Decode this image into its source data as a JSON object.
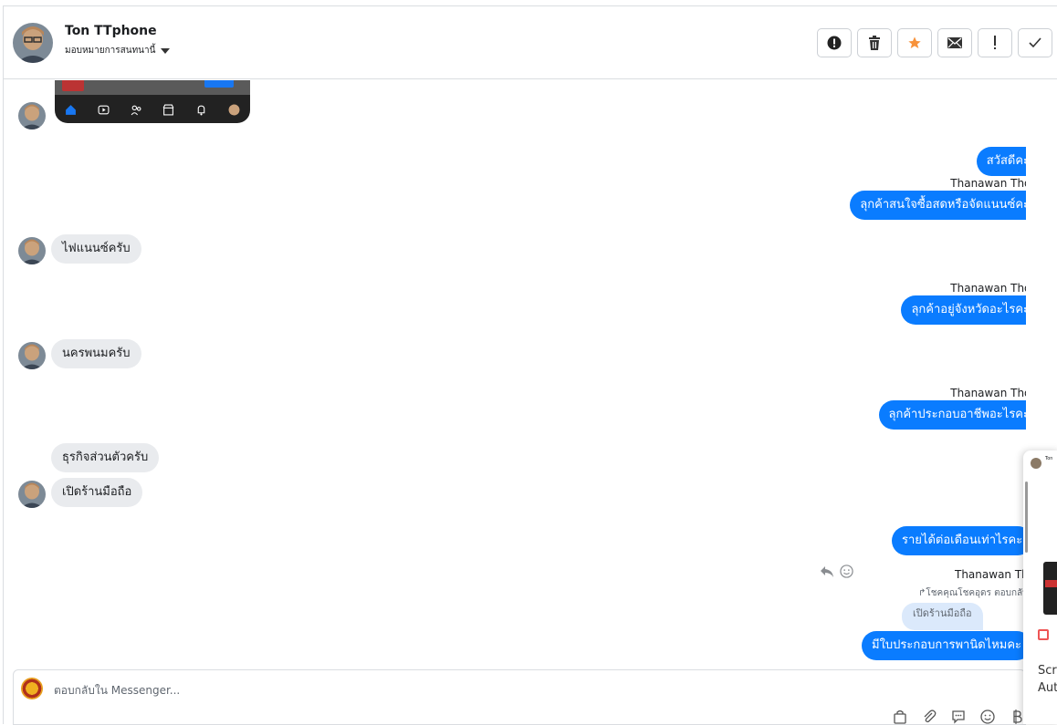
{
  "header": {
    "contact_name": "Ton TTphone",
    "assign_label": "มอบหมายการสนทนานี้",
    "actions": [
      {
        "name": "report-spam",
        "icon": "alert-circle-icon"
      },
      {
        "name": "delete",
        "icon": "trash-icon"
      },
      {
        "name": "star",
        "icon": "star-icon"
      },
      {
        "name": "mark-unread",
        "icon": "envelope-icon"
      },
      {
        "name": "mark-important",
        "icon": "exclamation-icon"
      },
      {
        "name": "mark-done",
        "icon": "check-icon"
      }
    ]
  },
  "colors": {
    "outgoing_bubble": "#0a7cff",
    "incoming_bubble": "#e9ebee",
    "star": "#f7923b",
    "quoted_bubble": "#dbe9fb"
  },
  "messages": {
    "m1": "สวัสดีคะ",
    "sender1": "Thanawan Thon",
    "m2": "ลุกค้าสนใจซื้อสดหรือจัดแนนซ์คะ",
    "m3": "ไฟแนนซ์ครับ",
    "sender2": "Thanawan Thon",
    "m4": "ลุกค้าอยู่จังหวัดอะไรคะ",
    "m5": "นครพนมครับ",
    "sender3": "Thanawan Thon",
    "m6": "ลุกค้าประกอบอาชีพอะไรคะ",
    "m7": "ธุรกิจส่วนตัวครับ",
    "m8": "เปิดร้านมือถือ",
    "m9": "รายได้ต่อเดือนเท่าไรคะ",
    "sender4": "Thanawan Thon",
    "reply_meta": "โชคคุณโชคอุดร ตอบกลับ",
    "quoted": "เปิดร้านมือถือ",
    "m10": "มีใบประกอบการพานิดไหมคะ"
  },
  "composer": {
    "placeholder": "ตอบกลับใน Messenger..."
  },
  "side_popup": {
    "name": "Ton",
    "line1": "Scr",
    "line2": "Aut"
  }
}
